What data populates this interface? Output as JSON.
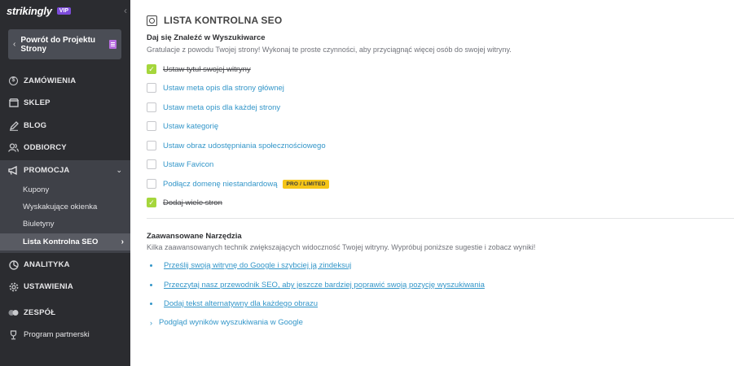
{
  "sidebar": {
    "logo": "strikingly",
    "vip_badge": "VIP",
    "back_button": {
      "line1": "Powrót do Projektu",
      "line2": "Strony"
    },
    "items": [
      {
        "label": "ZAMÓWIENIA",
        "icon": "dollar-icon"
      },
      {
        "label": "SKLEP",
        "icon": "store-icon"
      },
      {
        "label": "BLOG",
        "icon": "pen-icon"
      },
      {
        "label": "ODBIORCY",
        "icon": "users-icon"
      },
      {
        "label": "PROMOCJA",
        "icon": "megaphone-icon"
      },
      {
        "label": "ANALITYKA",
        "icon": "chart-icon"
      },
      {
        "label": "USTAWIENIA",
        "icon": "gear-icon"
      },
      {
        "label": "ZESPÓŁ",
        "icon": "team-icon"
      },
      {
        "label": "Program partnerski",
        "icon": "trophy-icon"
      }
    ],
    "promo_sub": [
      {
        "label": "Kupony"
      },
      {
        "label": "Wyskakujące okienka"
      },
      {
        "label": "Biuletyny"
      },
      {
        "label": "Lista Kontrolna SEO",
        "active": true
      }
    ]
  },
  "main": {
    "title": "LISTA KONTROLNA SEO",
    "section1": {
      "title": "Daj się Znaleźć w Wyszukiwarce",
      "desc": "Gratulacje z powodu Twojej strony! Wykonaj te proste czynności, aby przyciągnąć więcej osób do swojej witryny."
    },
    "checklist": [
      {
        "label": "Ustaw tytuł swojej witryny",
        "done": true
      },
      {
        "label": "Ustaw meta opis dla strony głównej",
        "done": false
      },
      {
        "label": "Ustaw meta opis dla każdej strony",
        "done": false
      },
      {
        "label": "Ustaw kategorię",
        "done": false
      },
      {
        "label": "Ustaw obraz udostępniania społecznościowego",
        "done": false
      },
      {
        "label": "Ustaw Favicon",
        "done": false
      },
      {
        "label": "Podłącz domenę niestandardową",
        "done": false,
        "badge": "PRO / LIMITED"
      },
      {
        "label": "Dodaj wiele stron",
        "done": true
      }
    ],
    "section2": {
      "title": "Zaawansowane Narzędzia",
      "desc": "Kilka zaawansowanych technik zwiększających widoczność Twojej witryny. Wypróbuj poniższe sugestie i zobacz wyniki!"
    },
    "links": [
      {
        "label": "Prześlij swoją witrynę do Google i szybciej ją zindeksuj"
      },
      {
        "label": "Przeczytaj nasz przewodnik SEO, aby jeszcze bardziej poprawić swoją pozycję wyszukiwania"
      },
      {
        "label": "Dodaj tekst alternatywny dla każdego obrazu"
      }
    ],
    "preview_link": "Podgląd wyników wyszukiwania w Google"
  },
  "colors": {
    "sidebar_bg": "#2b2c30",
    "promo_bg": "#3f4148",
    "active_bg": "#595b63",
    "link": "#3396c9",
    "check_green": "#a5d63c",
    "badge_yellow": "#f5c518",
    "vip_purple": "#7d4cdb"
  }
}
